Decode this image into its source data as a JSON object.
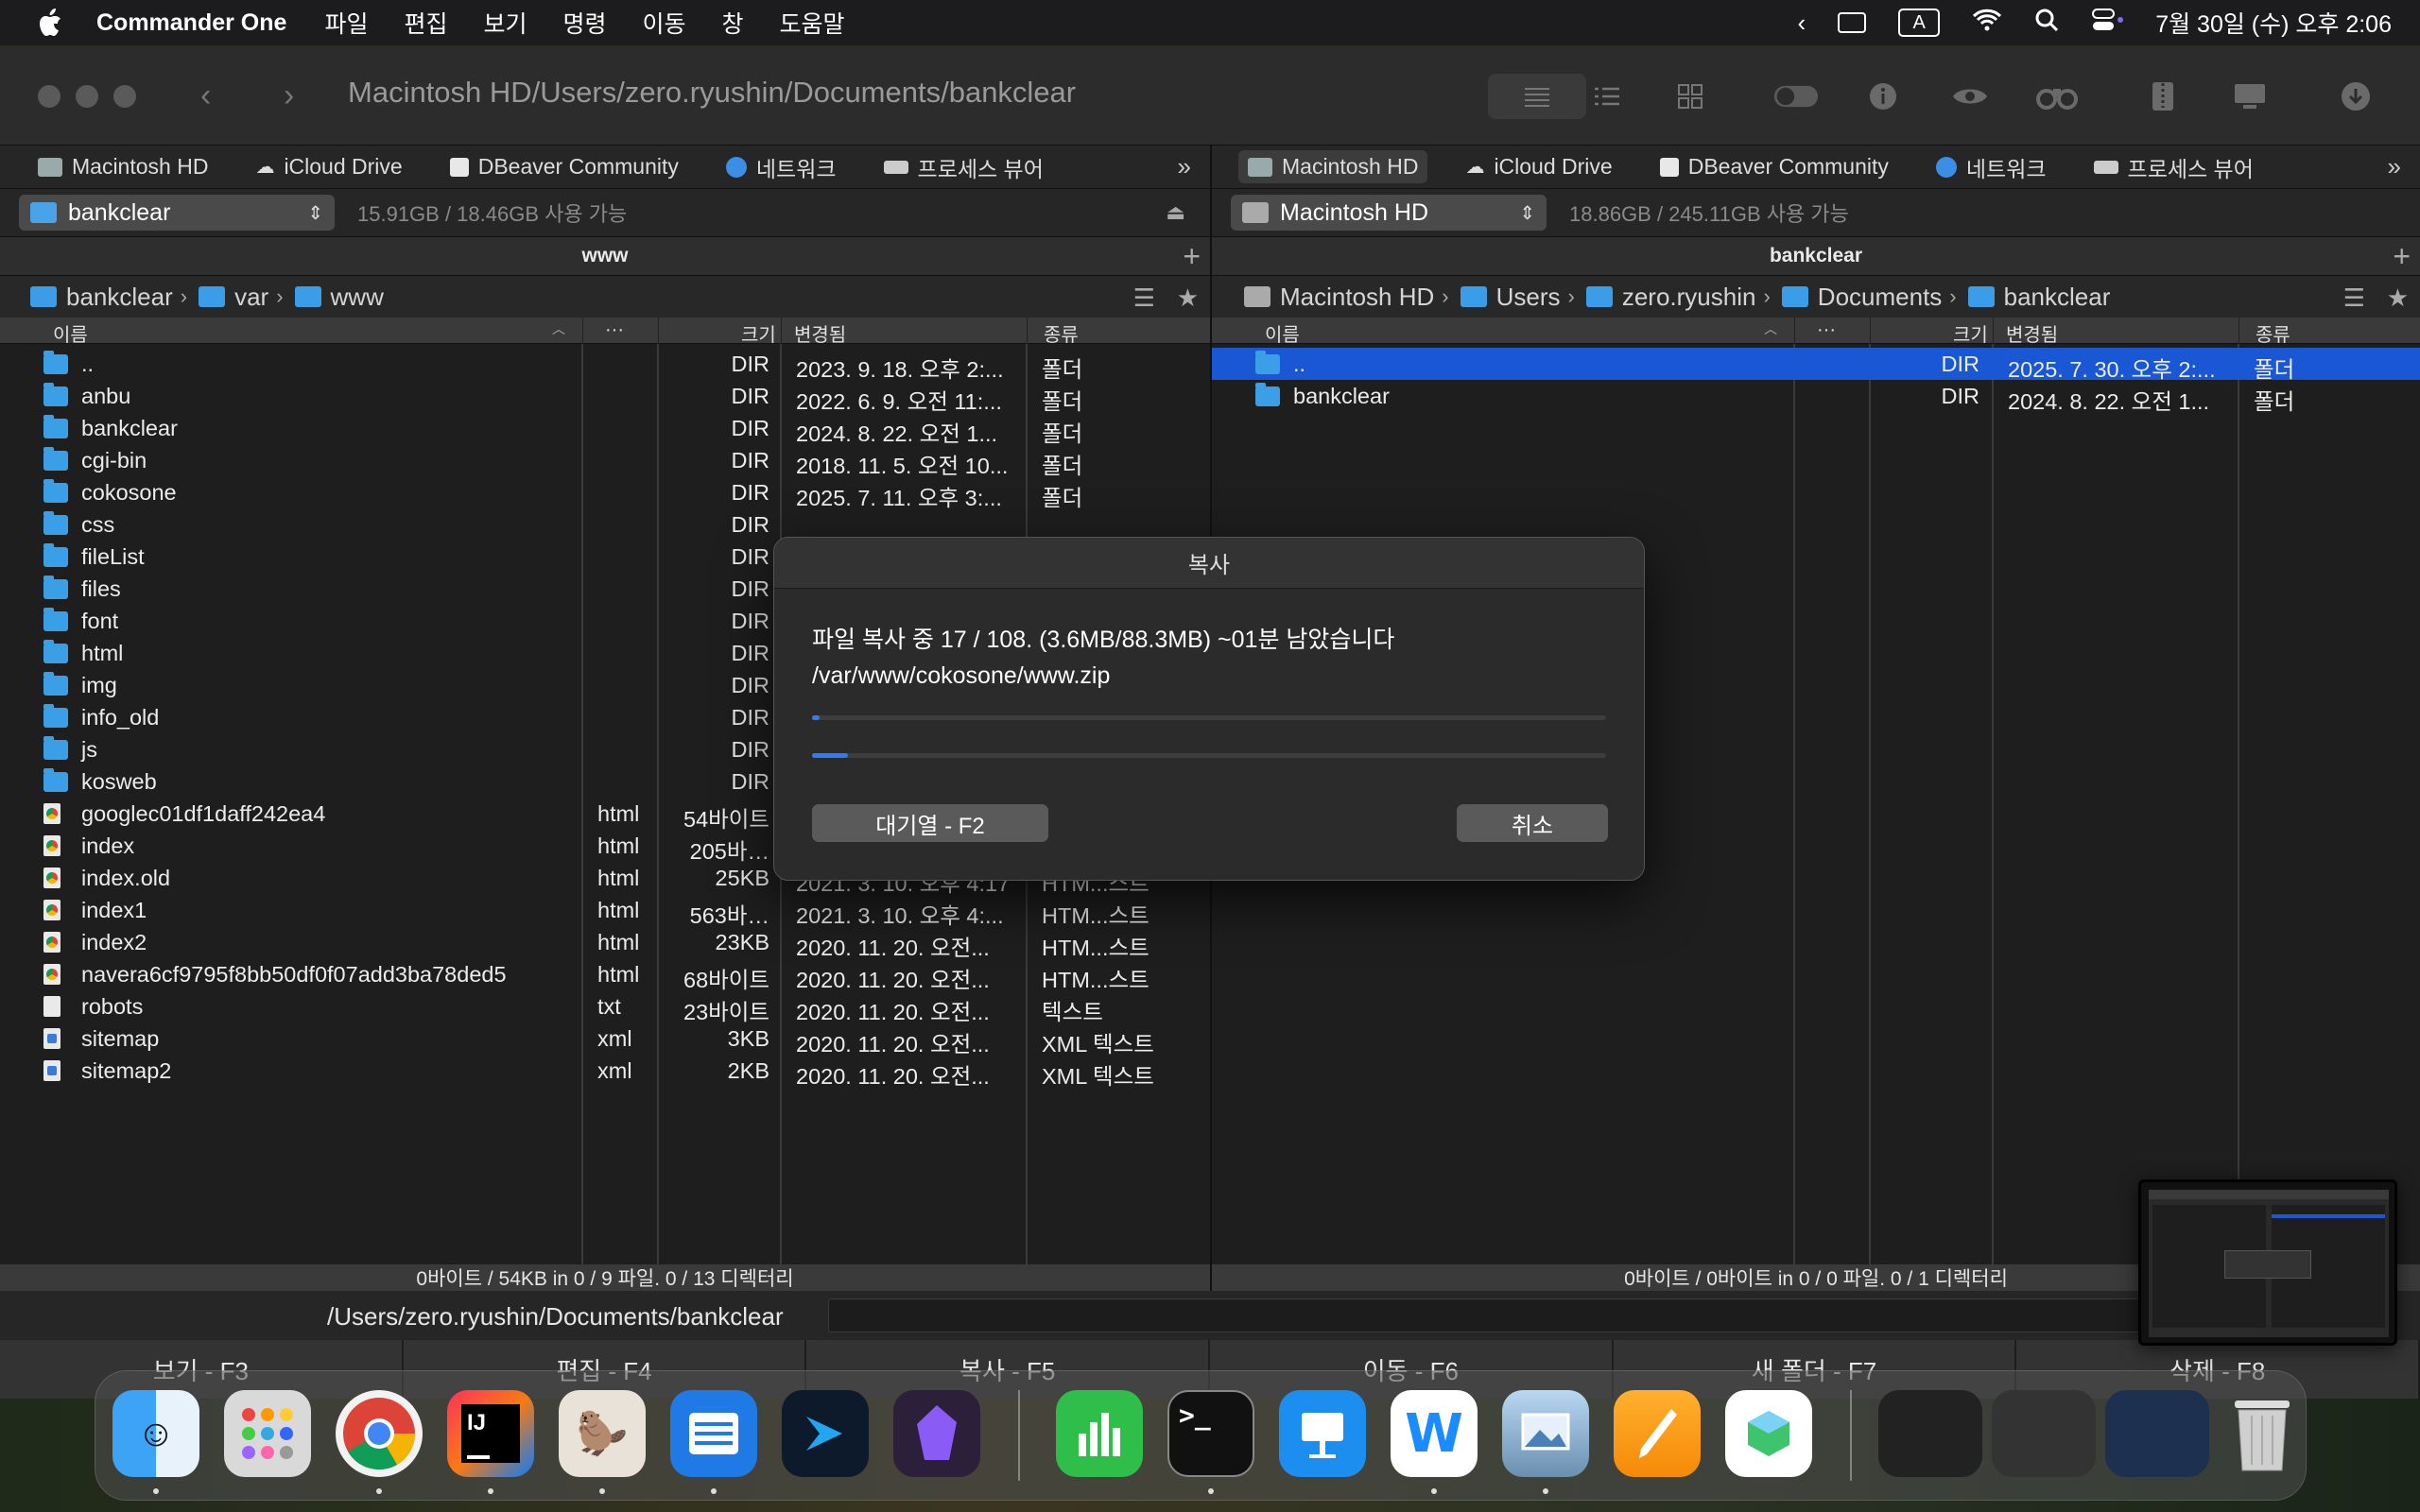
{
  "menubar": {
    "app": "Commander One",
    "items": [
      "파일",
      "편집",
      "보기",
      "명령",
      "이동",
      "창",
      "도움말"
    ],
    "input_source": "A",
    "clock": "7월 30일 (수) 오후 2:06"
  },
  "window": {
    "path_title": "Macintosh HD/Users/zero.ryushin/Documents/bankclear"
  },
  "left": {
    "favorites": [
      "Macintosh HD",
      "iCloud Drive",
      "DBeaver Community",
      "네트워크",
      "프로세스 뷰어"
    ],
    "drive": "bankclear",
    "space": "15.91GB / 18.46GB 사용 가능",
    "tab_title": "www",
    "breadcrumb": [
      "bankclear",
      "var",
      "www"
    ],
    "columns": {
      "name": "이름",
      "ext": "···",
      "size": "크기",
      "modified": "변경됨",
      "kind": "종류"
    },
    "rows": [
      {
        "name": "..",
        "ext": "",
        "size": "DIR",
        "date": "2023. 9. 18. 오후 2:...",
        "kind": "폴더",
        "type": "folder"
      },
      {
        "name": "anbu",
        "ext": "",
        "size": "DIR",
        "date": "2022. 6. 9. 오전 11:...",
        "kind": "폴더",
        "type": "folder"
      },
      {
        "name": "bankclear",
        "ext": "",
        "size": "DIR",
        "date": "2024. 8. 22. 오전 1...",
        "kind": "폴더",
        "type": "folder"
      },
      {
        "name": "cgi-bin",
        "ext": "",
        "size": "DIR",
        "date": "2018. 11. 5. 오전 10...",
        "kind": "폴더",
        "type": "folder"
      },
      {
        "name": "cokosone",
        "ext": "",
        "size": "DIR",
        "date": "2025. 7. 11. 오후 3:...",
        "kind": "폴더",
        "type": "folder"
      },
      {
        "name": "css",
        "ext": "",
        "size": "DIR",
        "date": "",
        "kind": "",
        "type": "folder"
      },
      {
        "name": "fileList",
        "ext": "",
        "size": "DIR",
        "date": "",
        "kind": "",
        "type": "folder"
      },
      {
        "name": "files",
        "ext": "",
        "size": "DIR",
        "date": "",
        "kind": "",
        "type": "folder"
      },
      {
        "name": "font",
        "ext": "",
        "size": "DIR",
        "date": "",
        "kind": "",
        "type": "folder"
      },
      {
        "name": "html",
        "ext": "",
        "size": "DIR",
        "date": "",
        "kind": "",
        "type": "folder"
      },
      {
        "name": "img",
        "ext": "",
        "size": "DIR",
        "date": "",
        "kind": "",
        "type": "folder"
      },
      {
        "name": "info_old",
        "ext": "",
        "size": "DIR",
        "date": "",
        "kind": "",
        "type": "folder"
      },
      {
        "name": "js",
        "ext": "",
        "size": "DIR",
        "date": "",
        "kind": "",
        "type": "folder"
      },
      {
        "name": "kosweb",
        "ext": "",
        "size": "DIR",
        "date": "",
        "kind": "",
        "type": "folder"
      },
      {
        "name": "googlec01df1daff242ea4",
        "ext": "html",
        "size": "54바이트",
        "date": "",
        "kind": "",
        "type": "html"
      },
      {
        "name": "index",
        "ext": "html",
        "size": "205바…",
        "date": "",
        "kind": "",
        "type": "html"
      },
      {
        "name": "index.old",
        "ext": "html",
        "size": "25KB",
        "date": "2021. 3. 10. 오후 4:17",
        "kind": "HTM...스트",
        "type": "html"
      },
      {
        "name": "index1",
        "ext": "html",
        "size": "563바…",
        "date": "2021. 3. 10. 오후 4:...",
        "kind": "HTM...스트",
        "type": "html"
      },
      {
        "name": "index2",
        "ext": "html",
        "size": "23KB",
        "date": "2020. 11. 20. 오전...",
        "kind": "HTM...스트",
        "type": "html"
      },
      {
        "name": "navera6cf9795f8bb50df0f07add3ba78ded5",
        "ext": "html",
        "size": "68바이트",
        "date": "2020. 11. 20. 오전...",
        "kind": "HTM...스트",
        "type": "html"
      },
      {
        "name": "robots",
        "ext": "txt",
        "size": "23바이트",
        "date": "2020. 11. 20. 오전...",
        "kind": "텍스트",
        "type": "txt"
      },
      {
        "name": "sitemap",
        "ext": "xml",
        "size": "3KB",
        "date": "2020. 11. 20. 오전...",
        "kind": "XML 텍스트",
        "type": "xml"
      },
      {
        "name": "sitemap2",
        "ext": "xml",
        "size": "2KB",
        "date": "2020. 11. 20. 오전...",
        "kind": "XML 텍스트",
        "type": "xml"
      }
    ],
    "status": "0바이트 / 54KB in 0 / 9 파일. 0 / 13 디렉터리"
  },
  "right": {
    "favorites": [
      "Macintosh HD",
      "iCloud Drive",
      "DBeaver Community",
      "네트워크",
      "프로세스 뷰어"
    ],
    "drive": "Macintosh HD",
    "space": "18.86GB / 245.11GB 사용 가능",
    "tab_title": "bankclear",
    "breadcrumb": [
      "Macintosh HD",
      "Users",
      "zero.ryushin",
      "Documents",
      "bankclear"
    ],
    "columns": {
      "name": "이름",
      "ext": "···",
      "size": "크기",
      "modified": "변경됨",
      "kind": "종류"
    },
    "rows": [
      {
        "name": "..",
        "ext": "",
        "size": "DIR",
        "date": "2025. 7. 30. 오후 2:...",
        "kind": "폴더",
        "type": "folder",
        "selected": true
      },
      {
        "name": "bankclear",
        "ext": "",
        "size": "DIR",
        "date": "2024. 8. 22. 오전 1...",
        "kind": "폴더",
        "type": "folder"
      }
    ],
    "status": "0바이트 / 0바이트 in 0 / 0 파일. 0 / 1 디렉터리"
  },
  "cmdline": {
    "path": "/Users/zero.ryushin/Documents/bankclear"
  },
  "fkeys": [
    "보기 - F3",
    "편집 - F4",
    "복사 - F5",
    "이동 - F6",
    "새 폴더 - F7",
    "삭제 - F8"
  ],
  "dialog": {
    "title": "복사",
    "line1": "파일 복사 중 17 / 108. (3.6MB/88.3MB) ~01분 남았습니다",
    "line2": "/var/www/cokosone/www.zip",
    "progress_file": 0.01,
    "progress_total": 0.045,
    "queue_label": "대기열 - F2",
    "cancel_label": "취소"
  },
  "dock": {
    "apps": [
      "Finder",
      "Launchpad",
      "Chrome",
      "IntelliJ IDEA",
      "DBeaver",
      "Commander One",
      "Xcode Cloud",
      "Obsidian",
      "Numbers",
      "Terminal",
      "Keynote",
      "Naver Whale",
      "Preview",
      "Pages",
      "Naver Works",
      "Trash"
    ]
  },
  "colors": {
    "selection": "#1a57d5",
    "folder": "#3a9fe6",
    "progress": "#2f7cf6"
  }
}
